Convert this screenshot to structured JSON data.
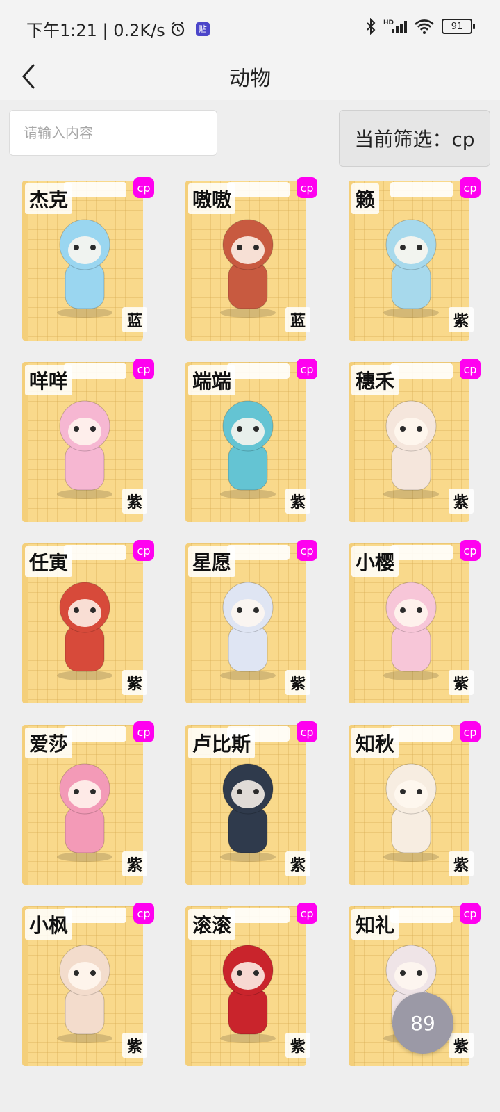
{
  "status_bar": {
    "time_speed": "下午1:21 | 0.2K/s",
    "tie_badge": "贴",
    "battery": "91"
  },
  "header": {
    "title": "动物"
  },
  "search": {
    "placeholder": "请输入内容",
    "value": ""
  },
  "filter": {
    "label": "当前筛选：cp"
  },
  "cards": [
    {
      "name": "杰克",
      "tag": "cp",
      "rarity": "蓝",
      "color": "#9ad6f0"
    },
    {
      "name": "嗷嗷",
      "tag": "cp",
      "rarity": "蓝",
      "color": "#c85a40"
    },
    {
      "name": "籁",
      "tag": "cp",
      "rarity": "紫",
      "color": "#a7d9ec"
    },
    {
      "name": "咩咩",
      "tag": "cp",
      "rarity": "紫",
      "color": "#f6b7d2"
    },
    {
      "name": "端端",
      "tag": "cp",
      "rarity": "紫",
      "color": "#64c4d3"
    },
    {
      "name": "穗禾",
      "tag": "cp",
      "rarity": "紫",
      "color": "#f5e6dc"
    },
    {
      "name": "任寅",
      "tag": "cp",
      "rarity": "紫",
      "color": "#d74a3a"
    },
    {
      "name": "星愿",
      "tag": "cp",
      "rarity": "紫",
      "color": "#dfe5f3"
    },
    {
      "name": "小樱",
      "tag": "cp",
      "rarity": "紫",
      "color": "#f7c6d8"
    },
    {
      "name": "爱莎",
      "tag": "cp",
      "rarity": "紫",
      "color": "#f39ab7"
    },
    {
      "name": "卢比斯",
      "tag": "cp",
      "rarity": "紫",
      "color": "#2f3a4c"
    },
    {
      "name": "知秋",
      "tag": "cp",
      "rarity": "紫",
      "color": "#f7ede1"
    },
    {
      "name": "小枫",
      "tag": "cp",
      "rarity": "紫",
      "color": "#f3dccc"
    },
    {
      "name": "滚滚",
      "tag": "cp",
      "rarity": "紫",
      "color": "#c9242c"
    },
    {
      "name": "知礼",
      "tag": "cp",
      "rarity": "紫",
      "color": "#efe4e7"
    }
  ],
  "counter": {
    "value": "89",
    "color": "#9b99a6"
  }
}
